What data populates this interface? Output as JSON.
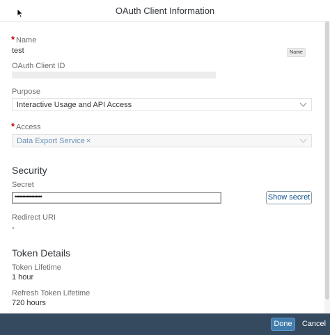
{
  "dialog": {
    "title": "OAuth Client Information"
  },
  "fields": {
    "name": {
      "required_marker": "*",
      "label": "Name",
      "value": "test",
      "tooltip": "Name"
    },
    "client_id": {
      "label": "OAuth Client ID"
    },
    "purpose": {
      "label": "Purpose",
      "selected": "Interactive Usage and API Access"
    },
    "access": {
      "required_marker": "*",
      "label": "Access",
      "token": "Data Export Service",
      "token_remove": "×"
    }
  },
  "security": {
    "title": "Security",
    "secret_label": "Secret",
    "secret_value": "••••••••••••••••••",
    "show_secret_label": "Show secret",
    "redirect_label": "Redirect URI",
    "redirect_value": "-"
  },
  "token_details": {
    "title": "Token Details",
    "lifetime_label": "Token Lifetime",
    "lifetime_value": "1 hour",
    "refresh_label": "Refresh Token Lifetime",
    "refresh_value": "720 hours"
  },
  "footer": {
    "done_label": "Done",
    "cancel_label": "Cancel"
  },
  "colors": {
    "footer_bg": "#354a5f",
    "primary_button": "#427cac",
    "required": "#bb0000",
    "token_text": "#6b91b8"
  }
}
